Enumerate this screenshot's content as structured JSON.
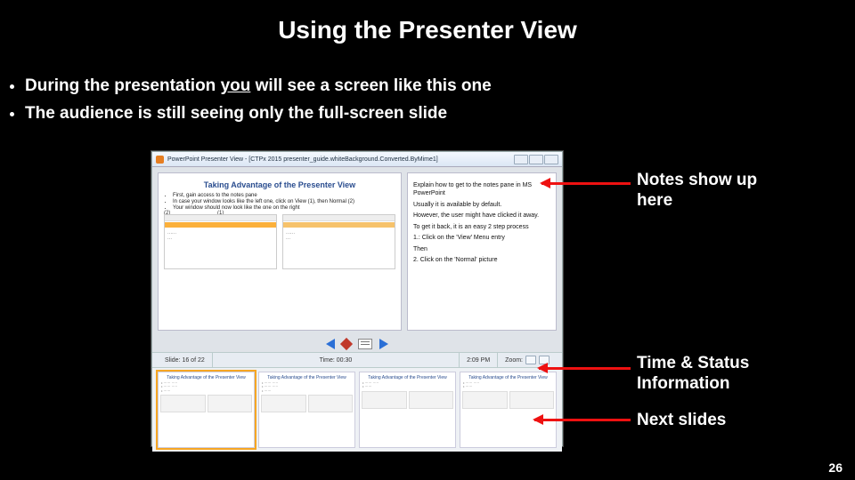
{
  "title": "Using the Presenter View",
  "bullets": {
    "b1_pre": "During the presentation ",
    "b1_em": "you",
    "b1_post": " will see a screen like this one",
    "b2": "The audience is still seeing only the full-screen slide"
  },
  "shot": {
    "window_title": "PowerPoint Presenter View - [CTPx 2015 presenter_guide.whiteBackground.Converted.ByMime1]",
    "slide_title": "Taking Advantage of the Presenter View",
    "slide_bul": [
      "First, gain access to the notes pane",
      "In case your window looks like the left one, click on View (1), then Normal (2)",
      "Your window should now look like the one on the right"
    ],
    "tag2": "(2)",
    "tag1": "(1)",
    "notes": {
      "n1": "Explain how to get to the notes pane in MS PowerPoint",
      "n2": "Usually it is available by default.",
      "n3": "However, the user might have clicked it away.",
      "n4": "To get it back, it is an easy 2 step process",
      "n5": "1.: Click on the 'View' Menu entry",
      "n6": "Then",
      "n7": "2. Click on the 'Normal' picture"
    },
    "status": {
      "slide": "Slide: 16 of 22",
      "time": "Time: 00:30",
      "clock": "2:09 PM",
      "zoom": "Zoom:"
    },
    "strip_title": "Taking Advantage of the Presenter View"
  },
  "annot": {
    "notes": "Notes show up here",
    "status": "Time & Status Information",
    "next": "Next slides"
  },
  "page_number": "26"
}
